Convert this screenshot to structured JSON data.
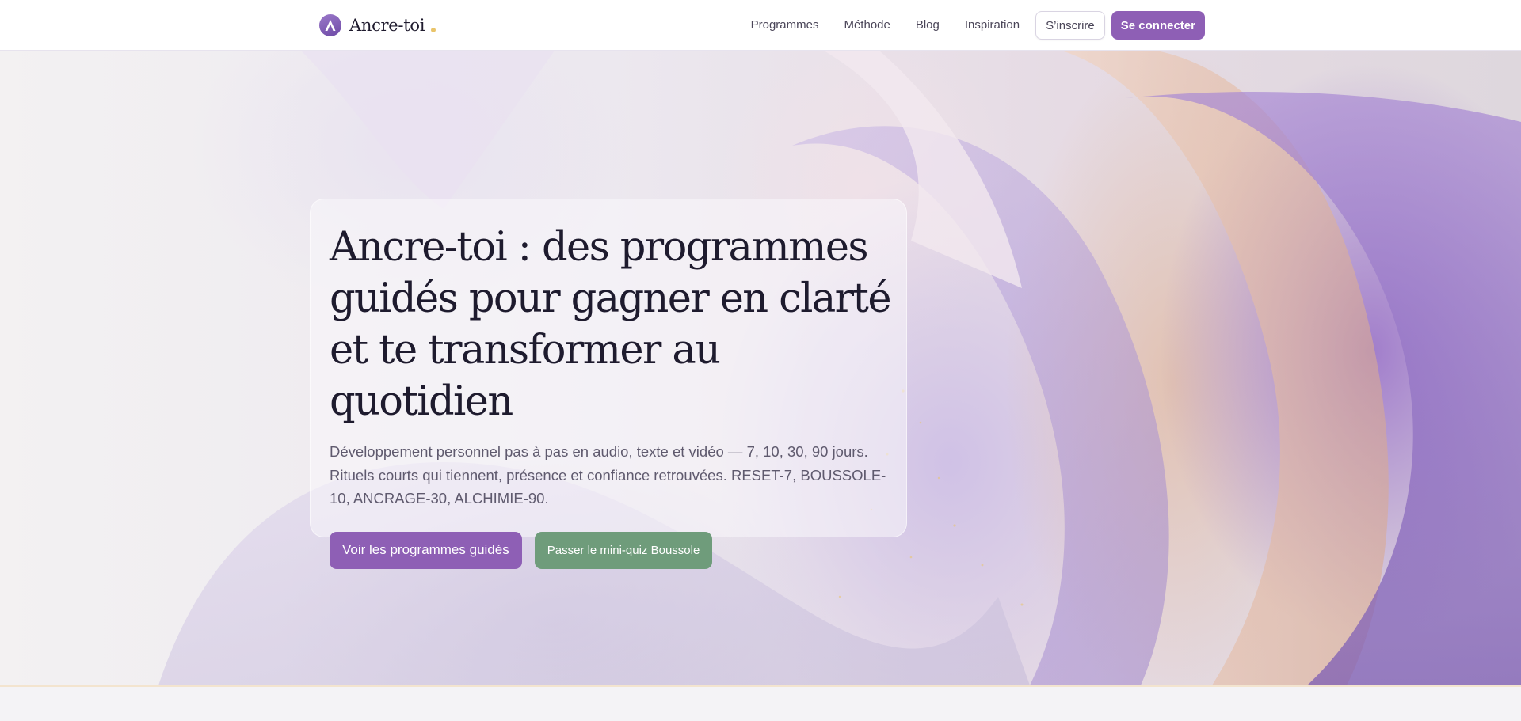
{
  "header": {
    "brand_name": "Ancre-toi",
    "nav": [
      {
        "label": "Programmes"
      },
      {
        "label": "Méthode"
      },
      {
        "label": "Blog"
      },
      {
        "label": "Inspiration"
      }
    ],
    "signup_label": "S’inscrire",
    "login_label": "Se connecter"
  },
  "hero": {
    "title": "Ancre-toi : des programmes guidés pour gagner en clarté et te transformer au quotidien",
    "subtitle": "Développement personnel pas à pas en audio, texte et vidéo — 7, 10, 30, 90 jours. Rituels courts qui tiennent, présence et confiance retrouvées. RESET-7, BOUSSOLE-10, ANCRAGE-30, ALCHIMIE-90.",
    "primary_cta": "Voir les programmes guidés",
    "secondary_cta": "Passer le mini-quiz Boussole"
  },
  "colors": {
    "accent": "#8e5fb5",
    "secondary": "#6f9c7b",
    "brand_dot": "#e9c46a"
  },
  "icons": {
    "brand_logo": "anchor-letter-a-icon"
  }
}
